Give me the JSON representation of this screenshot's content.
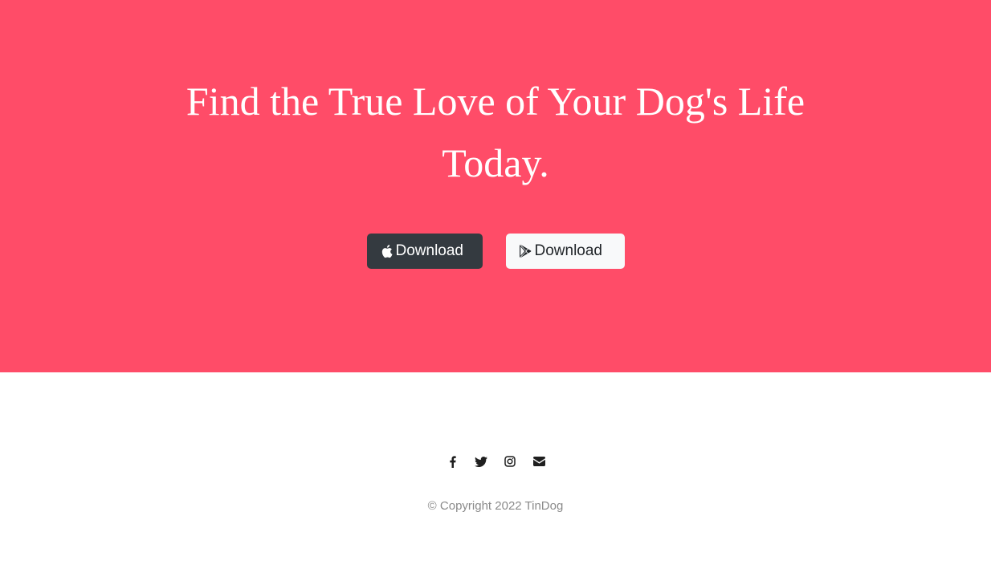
{
  "cta": {
    "heading": "Find the True Love of Your Dog's Life Today.",
    "background_color": "#ff4c68",
    "buttons": {
      "apple_label": "Download",
      "apple_icon": "apple-icon",
      "google_label": "Download",
      "google_icon": "google-play-icon"
    }
  },
  "footer": {
    "social_icons": [
      "facebook-icon",
      "twitter-icon",
      "instagram-icon",
      "envelope-icon"
    ],
    "copyright": "© Copyright 2022 TinDog"
  }
}
